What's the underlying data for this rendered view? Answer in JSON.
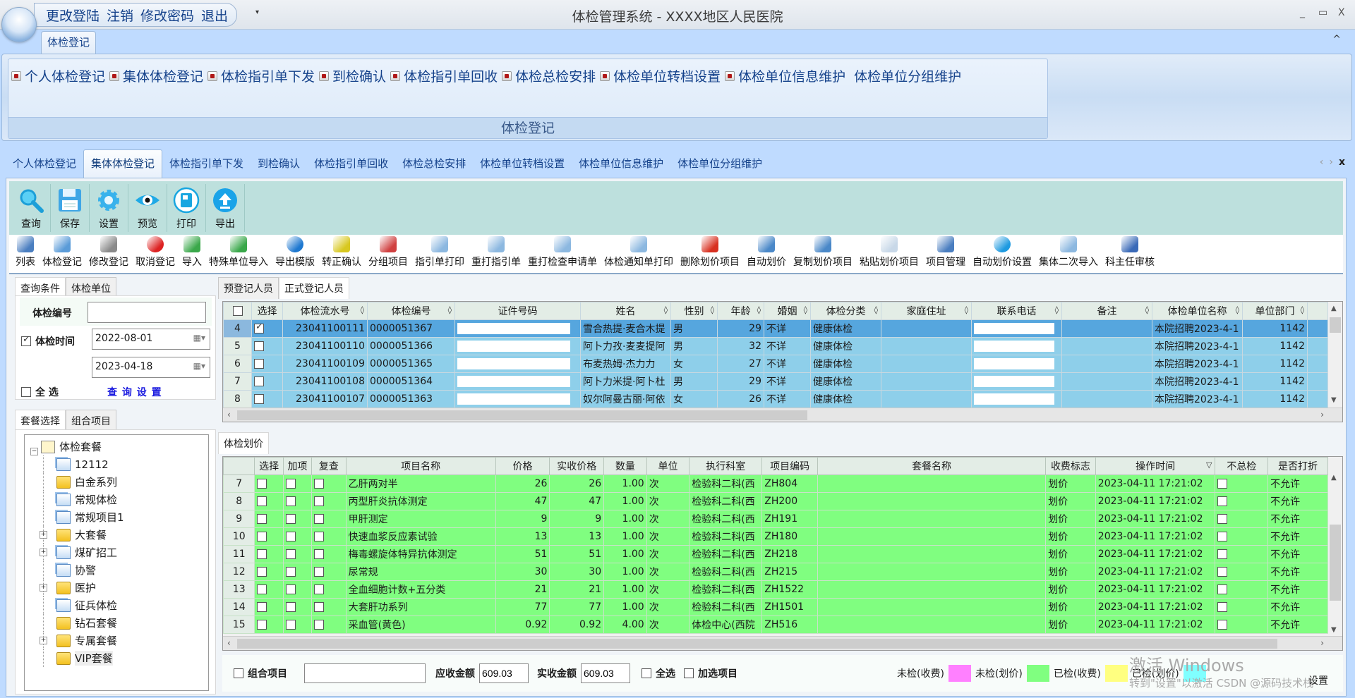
{
  "window": {
    "title": "体检管理系统   -  XXXX地区人民医院",
    "quick_access": [
      "更改登陆",
      "注销",
      "修改密码",
      "退出"
    ],
    "controls": {
      "minimize": "_",
      "maximize": "▭",
      "close": "X"
    }
  },
  "ribbon": {
    "active_tab": "体检登记",
    "items": [
      "个人体检登记",
      "集体体检登记",
      "体检指引单下发",
      "到检确认",
      "体检指引单回收",
      "体检总检安排",
      "体检单位转档设置",
      "体检单位信息维护",
      "体检单位分组维护"
    ],
    "group_label": "体检登记",
    "collapse_icon": "^"
  },
  "doc_tabs": {
    "items": [
      "个人体检登记",
      "集体体检登记",
      "体检指引单下发",
      "到检确认",
      "体检指引单回收",
      "体检总检安排",
      "体检单位转档设置",
      "体检单位信息维护",
      "体检单位分组维护"
    ],
    "active_index": 1,
    "nav_prev": "‹",
    "nav_next": "›",
    "close": "x"
  },
  "big_toolbar": [
    {
      "label": "查询",
      "icon": "search-icon"
    },
    {
      "label": "保存",
      "icon": "save-icon"
    },
    {
      "label": "设置",
      "icon": "gear-icon"
    },
    {
      "label": "预览",
      "icon": "eye-icon"
    },
    {
      "label": "打印",
      "icon": "print-icon"
    },
    {
      "label": "导出",
      "icon": "export-icon"
    }
  ],
  "small_toolbar": [
    {
      "label": "列表",
      "icon": "list-icon",
      "color": "#4a7ec0"
    },
    {
      "label": "体检登记",
      "icon": "register-icon",
      "color": "#5a9bd8"
    },
    {
      "label": "修改登记",
      "icon": "tools-icon",
      "color": "#8a8a8a"
    },
    {
      "label": "取消登记",
      "icon": "cancel-icon",
      "color": "#d22"
    },
    {
      "label": "导入",
      "icon": "import-icon",
      "color": "#3aa84a"
    },
    {
      "label": "特殊单位导入",
      "icon": "import-special-icon",
      "color": "#3aa84a"
    },
    {
      "label": "导出模版",
      "icon": "info-icon",
      "color": "#1e78d0"
    },
    {
      "label": "转正确认",
      "icon": "yuan-check-icon",
      "color": "#d8c820"
    },
    {
      "label": "分组项目",
      "icon": "group-icon",
      "color": "#d04040"
    },
    {
      "label": "指引单打印",
      "icon": "printer-icon",
      "color": "#8cb8e0"
    },
    {
      "label": "重打指引单",
      "icon": "printer-icon",
      "color": "#8cb8e0"
    },
    {
      "label": "重打检查申请单",
      "icon": "printer-icon",
      "color": "#8cb8e0"
    },
    {
      "label": "体检通知单打印",
      "icon": "printer-icon",
      "color": "#8cb8e0"
    },
    {
      "label": "删除划价项目",
      "icon": "locks-icon",
      "color": "#d83020"
    },
    {
      "label": "自动划价",
      "icon": "disk-price-icon",
      "color": "#4a88c8"
    },
    {
      "label": "复制划价项目",
      "icon": "copy-disk-icon",
      "color": "#4a88c8"
    },
    {
      "label": "粘贴划价项目",
      "icon": "paste-doc-icon",
      "color": "#c8d8e8"
    },
    {
      "label": "项目管理",
      "icon": "calendar-clock-icon",
      "color": "#4a7ec0"
    },
    {
      "label": "自动划价设置",
      "icon": "gear-blue-icon",
      "color": "#1e9ae0"
    },
    {
      "label": "集体二次导入",
      "icon": "printer-icon",
      "color": "#8cb8e0"
    },
    {
      "label": "科主任审核",
      "icon": "clipboard-pen-icon",
      "color": "#3a6ab8"
    }
  ],
  "query_panel": {
    "tabs": [
      "查询条件",
      "体检单位"
    ],
    "active_tab": 0,
    "exam_no_label": "体检编号",
    "exam_no_value": "",
    "exam_time_label": "体检时间",
    "exam_time_checked": true,
    "date_from": "2022-08-01",
    "date_to": "2023-04-18",
    "select_all_label": "全    选",
    "query_settings_link": "查 询 设 置"
  },
  "package_panel": {
    "tabs": [
      "套餐选择",
      "组合项目"
    ],
    "active_tab": 0,
    "root": "体检套餐",
    "nodes": [
      {
        "label": "12112",
        "type": "pkg",
        "expandable": false
      },
      {
        "label": "白金系列",
        "type": "folder",
        "expandable": false
      },
      {
        "label": "常规体检",
        "type": "pkg",
        "expandable": false
      },
      {
        "label": "常规项目1",
        "type": "pkg",
        "expandable": false
      },
      {
        "label": "大套餐",
        "type": "folder",
        "expandable": true
      },
      {
        "label": "煤矿招工",
        "type": "pkg",
        "expandable": true
      },
      {
        "label": "协警",
        "type": "pkg",
        "expandable": false
      },
      {
        "label": "医护",
        "type": "folder",
        "expandable": true
      },
      {
        "label": "征兵体检",
        "type": "pkg",
        "expandable": false
      },
      {
        "label": "钻石套餐",
        "type": "folder",
        "expandable": false
      },
      {
        "label": "专属套餐",
        "type": "folder",
        "expandable": true
      },
      {
        "label": "VIP套餐",
        "type": "folder",
        "expandable": false
      }
    ]
  },
  "person_grid": {
    "tabs": [
      "预登记人员",
      "正式登记人员"
    ],
    "active_tab": 1,
    "columns": [
      "选择",
      "体检流水号",
      "体检编号",
      "证件号码",
      "姓名",
      "性别",
      "年龄",
      "婚姻",
      "体检分类",
      "家庭住址",
      "联系电话",
      "备注",
      "体检单位名称",
      "单位部门"
    ],
    "rows": [
      {
        "rn": "4",
        "checked": true,
        "serial": "23041100111",
        "exam_no": "0000051367",
        "id_no": "",
        "name": "雪合热提·麦合木提",
        "sex": "男",
        "age": "29",
        "marital": "不详",
        "category": "健康体检",
        "address": "",
        "phone": "",
        "note": "",
        "unit": "本院招聘2023-4-1",
        "dept": "1142",
        "selected": true
      },
      {
        "rn": "5",
        "checked": false,
        "serial": "23041100110",
        "exam_no": "0000051366",
        "id_no": "",
        "name": "阿卜力孜·麦麦提阿",
        "sex": "男",
        "age": "32",
        "marital": "不详",
        "category": "健康体检",
        "address": "",
        "phone": "",
        "note": "",
        "unit": "本院招聘2023-4-1",
        "dept": "1142",
        "selected": false
      },
      {
        "rn": "6",
        "checked": false,
        "serial": "23041100109",
        "exam_no": "0000051365",
        "id_no": "",
        "name": "布麦热姆·杰力力",
        "sex": "女",
        "age": "27",
        "marital": "不详",
        "category": "健康体检",
        "address": "",
        "phone": "",
        "note": "",
        "unit": "本院招聘2023-4-1",
        "dept": "1142",
        "selected": false
      },
      {
        "rn": "7",
        "checked": false,
        "serial": "23041100108",
        "exam_no": "0000051364",
        "id_no": "",
        "name": "阿卜力米提·阿卜杜",
        "sex": "男",
        "age": "29",
        "marital": "不详",
        "category": "健康体检",
        "address": "",
        "phone": "",
        "note": "",
        "unit": "本院招聘2023-4-1",
        "dept": "1142",
        "selected": false
      },
      {
        "rn": "8",
        "checked": false,
        "serial": "23041100107",
        "exam_no": "0000051363",
        "id_no": "",
        "name": "奴尔阿曼古丽·阿依",
        "sex": "女",
        "age": "26",
        "marital": "不详",
        "category": "健康体检",
        "address": "",
        "phone": "",
        "note": "",
        "unit": "本院招聘2023-4-1",
        "dept": "1142",
        "selected": false
      }
    ]
  },
  "pricing_grid": {
    "tab": "体检划价",
    "columns": [
      "选择",
      "加项",
      "复查",
      "项目名称",
      "价格",
      "实收价格",
      "数量",
      "单位",
      "执行科室",
      "项目编码",
      "套餐名称",
      "收费标志",
      "操作时间",
      "不总检",
      "是否打折"
    ],
    "rows": [
      {
        "rn": "7",
        "name": "乙肝两对半",
        "price": "26",
        "paid": "26",
        "qty": "1.00",
        "unit": "次",
        "dept": "检验科二科(西",
        "code": "ZH804",
        "pkg": "",
        "flag": "划价",
        "time": "2023-04-11 17:21:02",
        "discount": "不允许"
      },
      {
        "rn": "8",
        "name": "丙型肝炎抗体测定",
        "price": "47",
        "paid": "47",
        "qty": "1.00",
        "unit": "次",
        "dept": "检验科二科(西",
        "code": "ZH200",
        "pkg": "",
        "flag": "划价",
        "time": "2023-04-11 17:21:02",
        "discount": "不允许"
      },
      {
        "rn": "9",
        "name": "甲肝测定",
        "price": "9",
        "paid": "9",
        "qty": "1.00",
        "unit": "次",
        "dept": "检验科二科(西",
        "code": "ZH191",
        "pkg": "",
        "flag": "划价",
        "time": "2023-04-11 17:21:02",
        "discount": "不允许"
      },
      {
        "rn": "10",
        "name": "快速血浆反应素试验",
        "price": "13",
        "paid": "13",
        "qty": "1.00",
        "unit": "次",
        "dept": "检验科二科(西",
        "code": "ZH180",
        "pkg": "",
        "flag": "划价",
        "time": "2023-04-11 17:21:02",
        "discount": "不允许"
      },
      {
        "rn": "11",
        "name": "梅毒螺旋体特异抗体测定",
        "price": "51",
        "paid": "51",
        "qty": "1.00",
        "unit": "次",
        "dept": "检验科二科(西",
        "code": "ZH218",
        "pkg": "",
        "flag": "划价",
        "time": "2023-04-11 17:21:02",
        "discount": "不允许"
      },
      {
        "rn": "12",
        "name": "尿常规",
        "price": "30",
        "paid": "30",
        "qty": "1.00",
        "unit": "次",
        "dept": "检验科二科(西",
        "code": "ZH215",
        "pkg": "",
        "flag": "划价",
        "time": "2023-04-11 17:21:02",
        "discount": "不允许"
      },
      {
        "rn": "13",
        "name": "全血细胞计数+五分类",
        "price": "21",
        "paid": "21",
        "qty": "1.00",
        "unit": "次",
        "dept": "检验科二科(西",
        "code": "ZH1522",
        "pkg": "",
        "flag": "划价",
        "time": "2023-04-11 17:21:02",
        "discount": "不允许"
      },
      {
        "rn": "14",
        "name": "大套肝功系列",
        "price": "77",
        "paid": "77",
        "qty": "1.00",
        "unit": "次",
        "dept": "检验科二科(西",
        "code": "ZH1501",
        "pkg": "",
        "flag": "划价",
        "time": "2023-04-11 17:21:02",
        "discount": "不允许"
      },
      {
        "rn": "15",
        "name": "采血管(黄色)",
        "price": "0.92",
        "paid": "0.92",
        "qty": "4.00",
        "unit": "次",
        "dept": "体检中心(西院",
        "code": "ZH516",
        "pkg": "",
        "flag": "划价",
        "time": "2023-04-11 17:21:02",
        "discount": "不允许"
      }
    ]
  },
  "bottom_bar": {
    "combo_label": "组合项目",
    "combo_value": "",
    "receivable_label": "应收金额",
    "receivable_value": "609.03",
    "paid_label": "实收金额",
    "paid_value": "609.03",
    "select_all_label": "全选",
    "extra_items_label": "加选项目",
    "legend": [
      {
        "label": "未检(收费)",
        "color": "#ff80ff"
      },
      {
        "label": "未检(划价)",
        "color": "#80ff80"
      },
      {
        "label": "已检(收费)",
        "color": "#ffff80"
      },
      {
        "label": "已检(划价)",
        "color": "#80ffff"
      }
    ],
    "settings_label": "设置"
  },
  "overlay": {
    "activate_windows": "激活 Windows",
    "activate_hint": "转到\"设置\"以激活 CSDN @源码技术栈"
  }
}
